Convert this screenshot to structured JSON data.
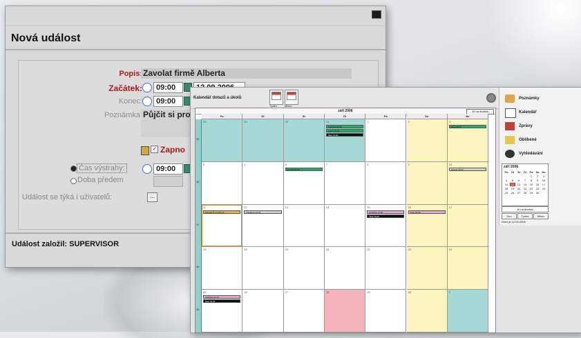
{
  "dialog": {
    "title": "Nová událost",
    "labels": {
      "description": "Popis:",
      "start": "Začátek:",
      "end": "Konec:",
      "note": "Poznámka:"
    },
    "description_value": "Zavolat firmě Alberta",
    "start_time": "09:00",
    "start_date": "12.09.2006",
    "end_time": "09:00",
    "note_value": "Půjčit si pro",
    "reminder_label": "Zapno",
    "radio_execution": "Čas výstrahy:",
    "radio_before": "Doba předem",
    "reminder_time": "09:00",
    "also_users_label": "Událost se týká i uživatelů:",
    "created_by": "Událost založil: SUPERVISOR"
  },
  "calendar_window": {
    "title": "Kalendář dotazů a úkolů",
    "toolbar": [
      {
        "label": "Týden",
        "icon": "calendar-week-icon"
      },
      {
        "label": "Měsíc",
        "icon": "calendar-month-icon"
      }
    ],
    "sidebar": [
      {
        "label": "Poznámky",
        "icon": "notes-icon"
      },
      {
        "label": "Kalendář",
        "icon": "calendar-icon"
      },
      {
        "label": "Zprávy",
        "icon": "messages-icon"
      },
      {
        "label": "Oblíbené",
        "icon": "favorites-icon"
      },
      {
        "label": "Vyhledávání",
        "icon": "search-icon"
      }
    ],
    "mini_calendar": {
      "title": "září 2006",
      "headers": [
        "Po",
        "Út",
        "St",
        "Čt",
        "Pá",
        "So",
        "Ne"
      ],
      "days": [
        "",
        "",
        "",
        "",
        "1",
        "2",
        "3",
        "4",
        "5",
        "6",
        "7",
        "8",
        "9",
        "10",
        "11",
        "12",
        "13",
        "14",
        "15",
        "16",
        "17",
        "18",
        "19",
        "20",
        "21",
        "22",
        "23",
        "24",
        "25",
        "26",
        "27",
        "28",
        "29",
        "30",
        ""
      ],
      "today": "12",
      "nav_label": "Jít na dnešek",
      "buttons": [
        "Den",
        "Týden",
        "Měsíc"
      ],
      "status": "Dnes je 12.09.2006"
    },
    "month": {
      "title": "září 2006",
      "today_button": "Jít na dnešek",
      "day_names": [
        "Po",
        "Út",
        "St",
        "Čt",
        "Pá",
        "So",
        "Ne"
      ],
      "week_numbers": [
        "35",
        "36",
        "37",
        "38",
        "39"
      ],
      "weeks": [
        [
          {
            "d": "28",
            "c": "#a6d8d6"
          },
          {
            "d": "29",
            "c": "#a6d8d6"
          },
          {
            "d": "30",
            "c": "#a6d8d6"
          },
          {
            "d": "31",
            "c": "#a6d8d6"
          },
          {
            "d": "1",
            "c": "#ffffff"
          },
          {
            "d": "2",
            "c": "#fbf5c0"
          },
          {
            "d": "3",
            "c": "#fbf5c0"
          }
        ],
        [
          {
            "d": "4",
            "c": "#ffffff"
          },
          {
            "d": "5",
            "c": "#ffffff"
          },
          {
            "d": "6",
            "c": "#ffffff"
          },
          {
            "d": "7",
            "c": "#ffffff"
          },
          {
            "d": "8",
            "c": "#ffffff"
          },
          {
            "d": "9",
            "c": "#fbf5c0"
          },
          {
            "d": "10",
            "c": "#fbf5c0"
          }
        ],
        [
          {
            "d": "11",
            "c": "#ffffff"
          },
          {
            "d": "12",
            "c": "#ffffff"
          },
          {
            "d": "13",
            "c": "#ffffff"
          },
          {
            "d": "14",
            "c": "#ffffff"
          },
          {
            "d": "15",
            "c": "#ffffff"
          },
          {
            "d": "16",
            "c": "#fbf5c0"
          },
          {
            "d": "17",
            "c": "#fbf5c0"
          }
        ],
        [
          {
            "d": "18",
            "c": "#ffffff"
          },
          {
            "d": "19",
            "c": "#ffffff"
          },
          {
            "d": "20",
            "c": "#ffffff"
          },
          {
            "d": "21",
            "c": "#ffffff"
          },
          {
            "d": "22",
            "c": "#ffffff"
          },
          {
            "d": "23",
            "c": "#fbf5c0"
          },
          {
            "d": "24",
            "c": "#fbf5c0"
          }
        ],
        [
          {
            "d": "25",
            "c": "#ffffff"
          },
          {
            "d": "26",
            "c": "#ffffff"
          },
          {
            "d": "27",
            "c": "#ffffff"
          },
          {
            "d": "28",
            "c": "#f3b4bb"
          },
          {
            "d": "29",
            "c": "#ffffff"
          },
          {
            "d": "30",
            "c": "#fbf5c0"
          },
          {
            "d": "1",
            "c": "#a6d8d6"
          }
        ]
      ],
      "events": [
        {
          "w": 0,
          "d": 3,
          "row": 0,
          "text": "Schůzka 09:00",
          "color": "#2ea86a"
        },
        {
          "w": 0,
          "d": 3,
          "row": 1,
          "text": "Hovor 10:00",
          "color": "#2ea86a"
        },
        {
          "w": 0,
          "d": 3,
          "row": 2,
          "text": "Úkol 14:00",
          "color": "#111111"
        },
        {
          "w": 0,
          "d": 6,
          "row": 0,
          "text": "Akce 08:00",
          "color": "#2ea86a"
        },
        {
          "w": 1,
          "d": 2,
          "row": 0,
          "text": "Porada 09:00",
          "color": "#2ea86a"
        },
        {
          "w": 1,
          "d": 6,
          "row": 0,
          "text": "Oslava 18:00",
          "color": "#d0d0d0"
        },
        {
          "w": 2,
          "d": 0,
          "row": 0,
          "text": "Zavolat firmě Alberta",
          "color": "#e8b24a"
        },
        {
          "w": 2,
          "d": 1,
          "row": 0,
          "text": "Návštěva 13:00",
          "color": "#d0d0d0"
        },
        {
          "w": 2,
          "d": 4,
          "row": 0,
          "text": "Schůzka 10:00",
          "color": "#e7a6cf"
        },
        {
          "w": 2,
          "d": 4,
          "row": 1,
          "text": "Úkol 16:00",
          "color": "#111111"
        },
        {
          "w": 2,
          "d": 5,
          "row": 0,
          "text": "Výlet 09:00",
          "color": "#e7a6cf"
        },
        {
          "w": 4,
          "d": 0,
          "row": 0,
          "text": "Schůzka 11:00",
          "color": "#e7a6cf"
        },
        {
          "w": 4,
          "d": 0,
          "row": 1,
          "text": "Úkol 15:00",
          "color": "#111111"
        }
      ]
    }
  }
}
